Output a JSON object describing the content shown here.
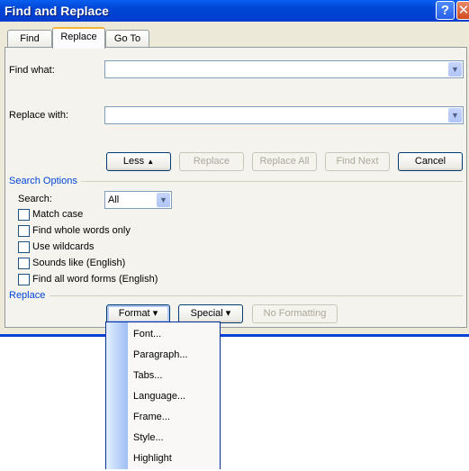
{
  "window": {
    "title": "Find and Replace",
    "help": "?",
    "close": "✕"
  },
  "tabs": [
    {
      "label": "Find",
      "active": false
    },
    {
      "label": "Replace",
      "active": true
    },
    {
      "label": "Go To",
      "active": false
    }
  ],
  "find_what": {
    "label": "Find what:",
    "value": ""
  },
  "replace_with": {
    "label": "Replace with:",
    "value": ""
  },
  "buttons": {
    "less": "Less",
    "less_icon": "▲",
    "replace": "Replace",
    "replace_all": "Replace All",
    "find_next": "Find Next",
    "cancel": "Cancel"
  },
  "search_options": {
    "heading": "Search Options",
    "search_label": "Search:",
    "search_value": "All",
    "checkboxes": [
      {
        "label": "Match case",
        "checked": false
      },
      {
        "label": "Find whole words only",
        "checked": false
      },
      {
        "label": "Use wildcards",
        "checked": false
      },
      {
        "label": "Sounds like (English)",
        "checked": false
      },
      {
        "label": "Find all word forms (English)",
        "checked": false
      }
    ]
  },
  "replace_section": {
    "heading": "Replace",
    "format": "Format",
    "special": "Special",
    "no_formatting": "No Formatting",
    "arrow": "▾"
  },
  "format_menu": [
    "Font...",
    "Paragraph...",
    "Tabs...",
    "Language...",
    "Frame...",
    "Style...",
    "Highlight"
  ]
}
